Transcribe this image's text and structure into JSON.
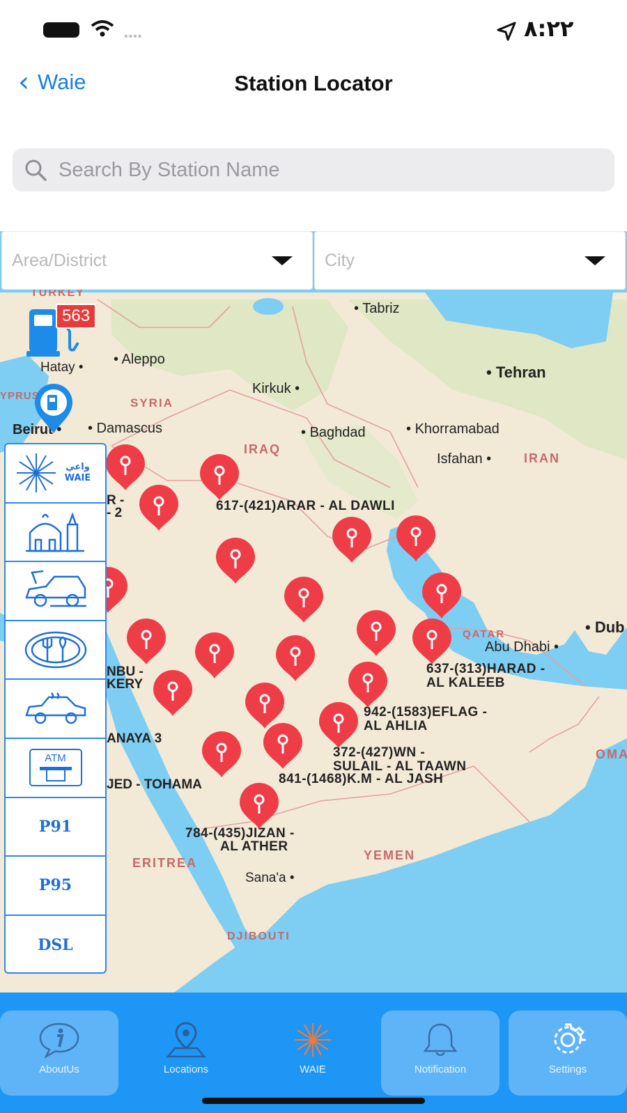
{
  "status_bar": {
    "time": "٨:٢٢"
  },
  "nav": {
    "back_label": "Waie",
    "title": "Station Locator"
  },
  "search": {
    "placeholder": "Search By Station Name"
  },
  "filters": {
    "area_placeholder": "Area/District",
    "city_placeholder": "City"
  },
  "map": {
    "cluster_count": "563",
    "country_labels": [
      "TURKEY",
      "SYRIA",
      "IRAQ",
      "IRAN",
      "QATAR",
      "YEMEN",
      "ERITREA",
      "DJIBOUTI",
      "OMA",
      "YPRUS"
    ],
    "city_labels": [
      "Tabriz",
      "Tehran",
      "Aleppo",
      "Hatay",
      "Kirkuk",
      "Beirut",
      "Damascus",
      "Baghdad",
      "Khorramabad",
      "Isfahan",
      "Abu Dhabi",
      "Dub",
      "Sana'a"
    ],
    "station_labels": [
      "617-(421)ARAR - AL DAWLI",
      "637-(313)HARAD -",
      "AL KALEEB",
      "942-(1583)EFLAG -",
      "AL AHLIA",
      "372-(427)WN -",
      "SULAIL - AL TAAWN",
      "841-(1468)K.M - AL JASH",
      "784-(435)JIZAN -",
      "AL ATHER",
      "R -",
      "- 2",
      "NBU -",
      "KERY",
      "ANAYA 3",
      "JED - TOHAMA"
    ]
  },
  "sidebar": {
    "logo_text": "واعي WAIE",
    "items": [
      {
        "icon": "mosque-icon"
      },
      {
        "icon": "car-service-icon"
      },
      {
        "icon": "restaurant-icon"
      },
      {
        "icon": "car-wash-icon"
      },
      {
        "icon": "atm-icon",
        "label": "ATM"
      },
      {
        "label": "P91"
      },
      {
        "label": "P95"
      },
      {
        "label": "DSL"
      }
    ]
  },
  "tabs": [
    {
      "label": "AboutUs",
      "icon": "info-bubble-icon"
    },
    {
      "label": "Locations",
      "icon": "location-map-icon"
    },
    {
      "label": "WAIE",
      "icon": "waie-logo-icon"
    },
    {
      "label": "Notification",
      "icon": "bell-icon"
    },
    {
      "label": "Settings",
      "icon": "gear-icon"
    }
  ],
  "colors": {
    "accent": "#1a7ee6",
    "tabbar": "#1d96f5",
    "pin": "#ef3d48",
    "sea": "#7ecdf2",
    "land": "#f2ead7"
  }
}
